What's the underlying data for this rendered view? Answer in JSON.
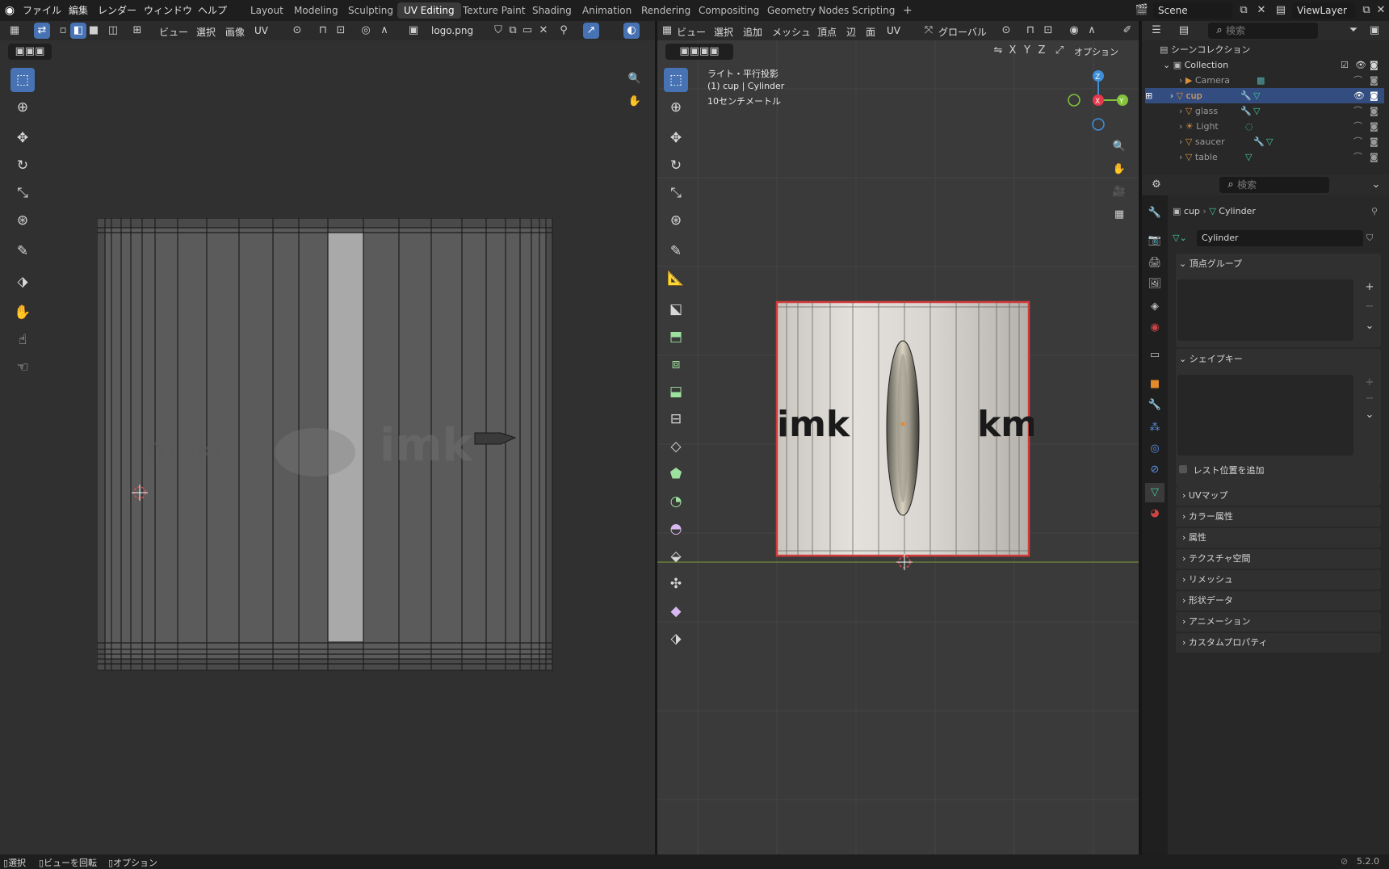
{
  "topbar": {
    "menus": [
      "ファイル",
      "編集",
      "レンダー",
      "ウィンドウ",
      "ヘルプ"
    ],
    "workspaces": [
      "Layout",
      "Modeling",
      "Sculpting",
      "UV Editing",
      "Texture Paint",
      "Shading",
      "Animation",
      "Rendering",
      "Compositing",
      "Geometry Nodes",
      "Scripting"
    ],
    "active_workspace": "UV Editing",
    "add_tab": "+",
    "scene_label": "Scene",
    "viewlayer_label": "ViewLayer"
  },
  "uv_editor": {
    "menus": [
      "ビュー",
      "選択",
      "画像",
      "UV"
    ],
    "image_name": "logo.png"
  },
  "viewport": {
    "menus": [
      "ビュー",
      "選択",
      "追加",
      "メッシュ",
      "頂点",
      "辺",
      "面",
      "UV"
    ],
    "transform_orientation": "グローバル",
    "options_label": "オプション",
    "axis_labels": [
      "X",
      "Y",
      "Z"
    ],
    "overlay": {
      "line1": "ライト・平行投影",
      "line2": "(1) cup | Cylinder",
      "line3": "10センチメートル"
    },
    "gizmo": {
      "z": "Z",
      "y": "Y",
      "x": "X"
    },
    "decal_left": "imk",
    "decal_right": "kmi"
  },
  "outliner": {
    "search_placeholder": "検索",
    "root": "シーンコレクション",
    "collection": "Collection",
    "items": [
      {
        "name": "Camera",
        "selected": false
      },
      {
        "name": "cup",
        "selected": true
      },
      {
        "name": "glass",
        "selected": false
      },
      {
        "name": "Light",
        "selected": false
      },
      {
        "name": "saucer",
        "selected": false
      },
      {
        "name": "table",
        "selected": false
      }
    ]
  },
  "properties": {
    "search_placeholder": "検索",
    "breadcrumb_object": "cup",
    "breadcrumb_data": "Cylinder",
    "mesh_name": "Cylinder",
    "panels": {
      "vertex_groups": "頂点グループ",
      "shape_keys": "シェイプキー",
      "add_rest_position": "レスト位置を追加",
      "uv_maps": "UVマップ",
      "color_attributes": "カラー属性",
      "attributes": "属性",
      "texture_space": "テクスチャ空間",
      "remesh": "リメッシュ",
      "geometry_data": "形状データ",
      "animation": "アニメーション",
      "custom_props": "カスタムプロパティ"
    }
  },
  "statusbar": {
    "select": "選択",
    "rotate_view": "ビューを回転",
    "options": "オプション",
    "version": "5.2.0"
  },
  "colors": {
    "accent_blue": "#4772b3",
    "selection_red": "#d43a3a",
    "axis_x": "#e8394c",
    "axis_y": "#84c23a",
    "axis_z": "#3e8ed8"
  }
}
